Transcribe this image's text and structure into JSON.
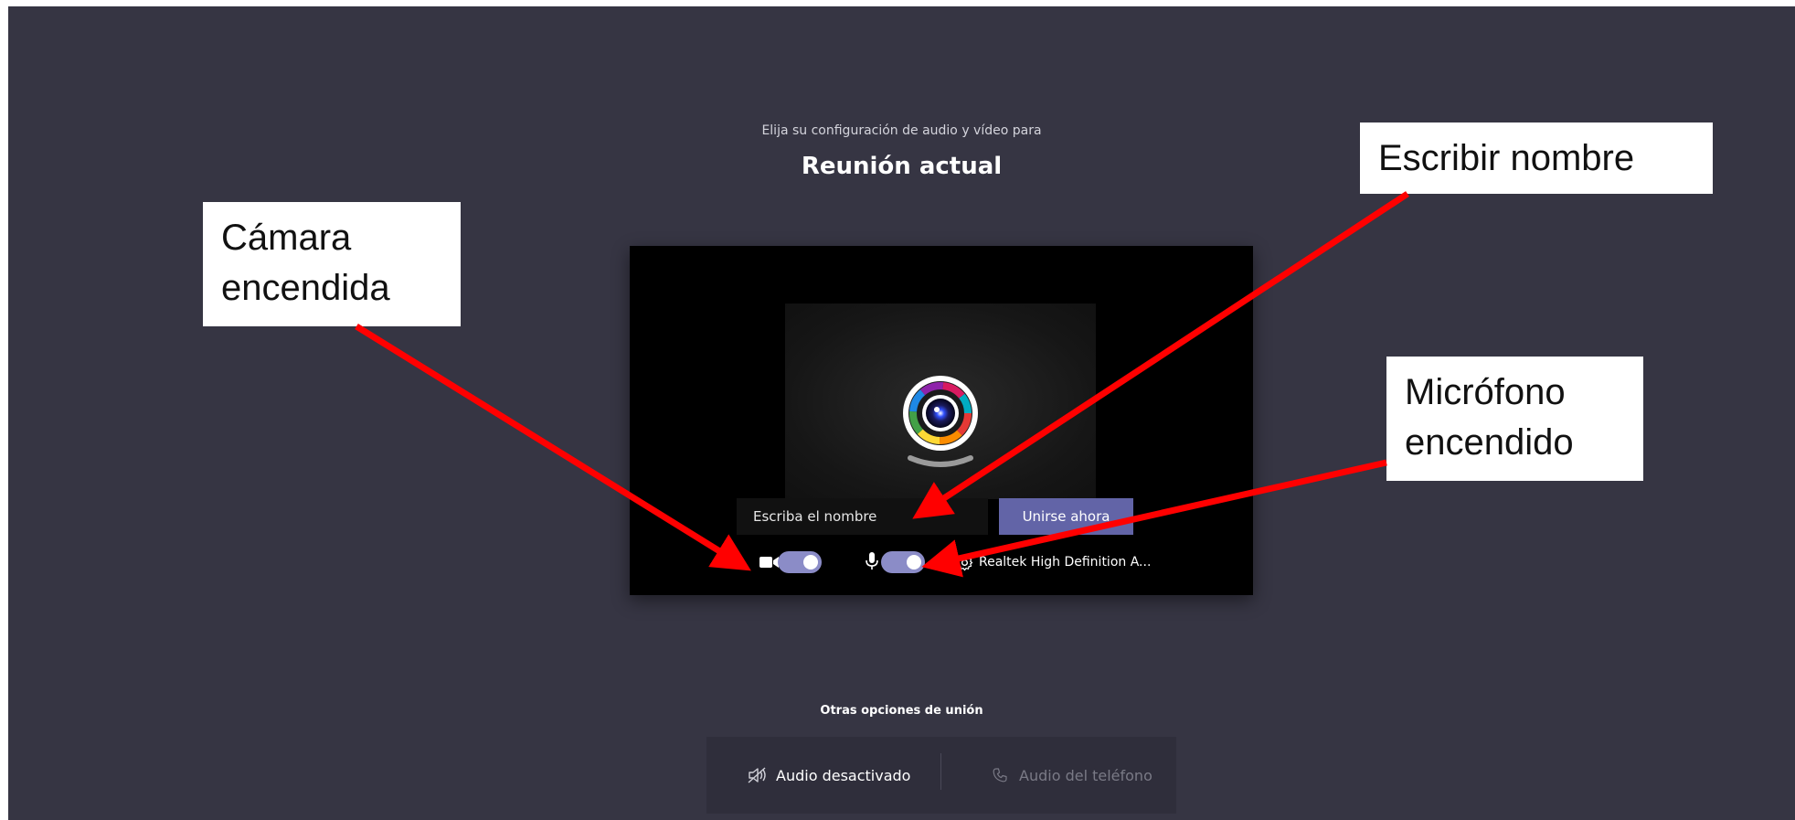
{
  "header": {
    "subtitle": "Elija su configuración de audio y vídeo para",
    "title": "Reunión actual"
  },
  "preview": {
    "name_placeholder": "Escriba el nombre",
    "join_label": "Unirse ahora",
    "camera_on": true,
    "mic_on": true,
    "audio_device": "Realtek High Definition A..."
  },
  "other_options": {
    "label": "Otras opciones de unión",
    "audio_off_label": "Audio desactivado",
    "phone_audio_label": "Audio del teléfono"
  },
  "annotations": {
    "camera": [
      "Cámara",
      "encendida"
    ],
    "name": "Escribir nombre",
    "mic": [
      "Micrófono",
      "encendido"
    ]
  },
  "colors": {
    "background": "#363543",
    "accent": "#6264a7",
    "toggle_on": "#8b8cc7",
    "arrow": "#ff0000"
  }
}
